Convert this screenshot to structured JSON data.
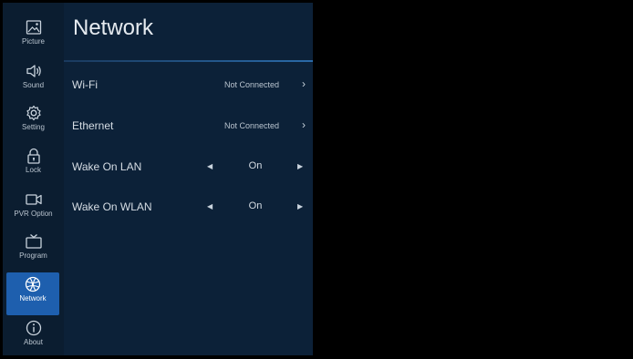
{
  "sidebar": {
    "items": [
      {
        "label": "Picture",
        "icon": "picture-icon"
      },
      {
        "label": "Sound",
        "icon": "speaker-icon"
      },
      {
        "label": "Setting",
        "icon": "gear-icon"
      },
      {
        "label": "Lock",
        "icon": "lock-icon"
      },
      {
        "label": "PVR Option",
        "icon": "camera-icon"
      },
      {
        "label": "Program",
        "icon": "tv-icon"
      },
      {
        "label": "Network",
        "icon": "globe-icon",
        "active": true
      },
      {
        "label": "About",
        "icon": "info-icon"
      }
    ]
  },
  "panel": {
    "title": "Network",
    "rows": [
      {
        "name": "Wi-Fi",
        "value": "Not Connected"
      },
      {
        "name": "Ethernet",
        "value": "Not Connected"
      },
      {
        "name": "Wake On LAN",
        "value": "On"
      },
      {
        "name": "Wake On WLAN",
        "value": "On"
      }
    ]
  },
  "colors": {
    "sidebar_bg": "#0b1d30",
    "panel_bg": "#0c2138",
    "active_bg": "#1e5fae"
  }
}
